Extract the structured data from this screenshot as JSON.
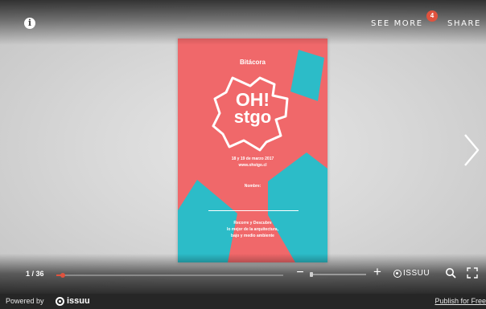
{
  "toolbar": {
    "info_icon": "info-icon",
    "see_more_label": "SEE MORE",
    "notification_count": "4",
    "share_label": "SHARE"
  },
  "document": {
    "title": "Bitácora",
    "logo_line1": "OH!",
    "logo_line2": "stgo",
    "date_line": "18 y 19 de marzo 2017",
    "url_line": "www.ohstgo.cl",
    "name_label": "Nombre:",
    "tagline_1": "Recorre y Descubre",
    "tagline_2": "lo mejor de la arquitectura,",
    "tagline_3": "bajo y medio ambiente",
    "colors": {
      "background": "#f0686a",
      "accent": "#2cbcc8"
    }
  },
  "controls": {
    "page_counter": "1 / 36",
    "progress_fraction": 0.028,
    "zoom_fraction": 0.0,
    "zoom_out_icon": "minus-icon",
    "zoom_in_icon": "plus-icon",
    "issuu_label": "ISSUU",
    "search_icon": "search-icon",
    "fullscreen_icon": "fullscreen-icon",
    "next_icon": "chevron-right-icon"
  },
  "footer": {
    "powered_by": "Powered by",
    "brand": "issuu",
    "publish_link": "Publish for Free"
  },
  "theme": {
    "accent": "#e0523e",
    "footer_bg": "#262626"
  }
}
